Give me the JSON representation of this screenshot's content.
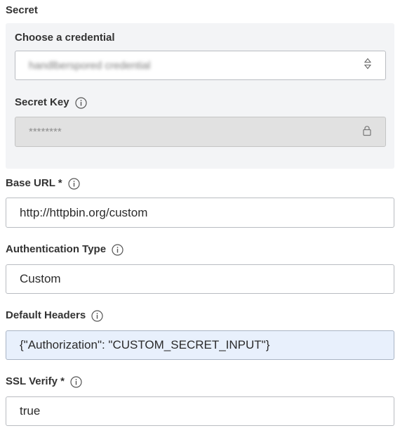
{
  "secret": {
    "section_label": "Secret",
    "credential": {
      "label": "Choose a credential",
      "value": "handlberspored credential"
    },
    "secret_key": {
      "label": "Secret Key",
      "value": "********"
    }
  },
  "base_url": {
    "label": "Base URL *",
    "value": "http://httpbin.org/custom"
  },
  "auth_type": {
    "label": "Authentication Type",
    "value": "Custom"
  },
  "default_headers": {
    "label": "Default Headers",
    "value": "{\"Authorization\": \"CUSTOM_SECRET_INPUT\"}"
  },
  "ssl_verify": {
    "label": "SSL Verify *",
    "value": "true"
  },
  "colors": {
    "panel_bg": "#f3f4f6",
    "field_border": "#b9bcc1",
    "disabled_bg": "#e1e1e1",
    "highlight_bg": "#e8f0fc"
  }
}
